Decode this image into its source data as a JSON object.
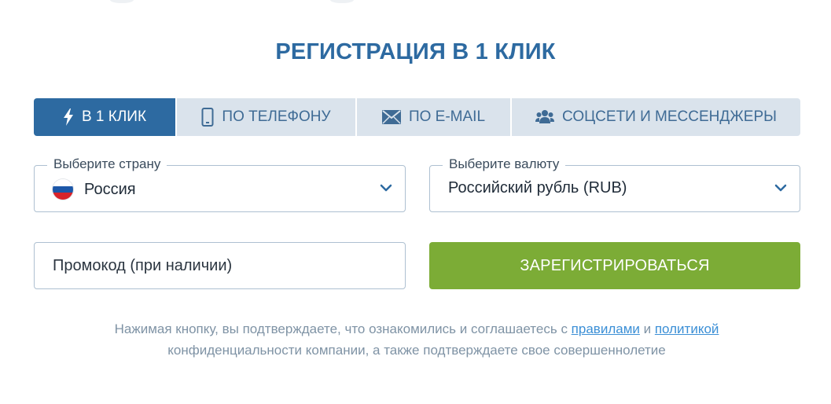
{
  "title": "РЕГИСТРАЦИЯ В 1 КЛИК",
  "tabs": [
    {
      "label": "В 1 КЛИК",
      "icon": "lightning-icon",
      "active": true
    },
    {
      "label": "ПО ТЕЛЕФОНУ",
      "icon": "phone-icon",
      "active": false
    },
    {
      "label": "ПО E-MAIL",
      "icon": "envelope-icon",
      "active": false
    },
    {
      "label": "СОЦСЕТИ И МЕССЕНДЖЕРЫ",
      "icon": "users-icon",
      "active": false
    }
  ],
  "country": {
    "legend": "Выберите страну",
    "value": "Россия",
    "icon": "russia-flag-icon"
  },
  "currency": {
    "legend": "Выберите валюту",
    "value": "Российский рубль (RUB)"
  },
  "promo": {
    "placeholder": "Промокод (при наличии)"
  },
  "submit_label": "ЗАРЕГИСТРИРОВАТЬСЯ",
  "terms": {
    "text_before": "Нажимая кнопку, вы подтверждаете, что ознакомились и соглашаетесь с ",
    "link_rules": "правилами",
    "text_and": " и ",
    "link_policy": "политикой",
    "text_after": " конфиденциальности компании, а также подтверждаете свое совершеннолетие"
  },
  "colors": {
    "accent": "#2d6aa1",
    "tab_inactive": "#dae3ec",
    "button": "#7cac36",
    "link": "#3b8fd6"
  }
}
